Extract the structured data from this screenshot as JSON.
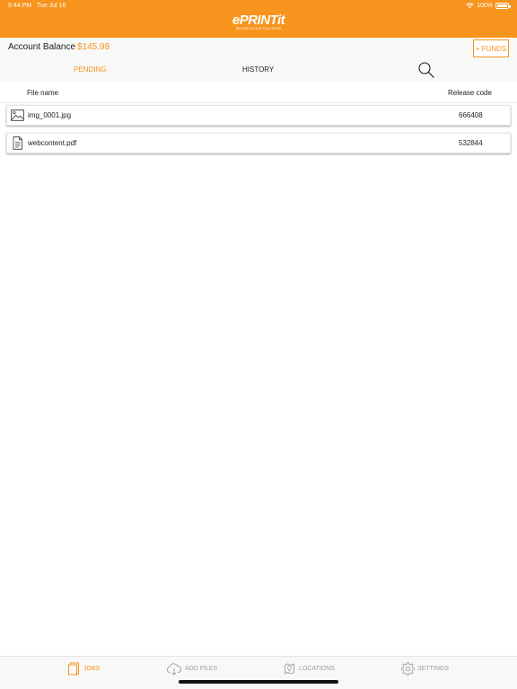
{
  "status_bar": {
    "time": "5:44 PM",
    "date": "Tue Jul 16",
    "battery": "100%"
  },
  "logo": {
    "name": "ePRINTit",
    "tagline": "SECURE CLOUD SOLUTIONS"
  },
  "account": {
    "label": "Account Balance",
    "balance": "$145.98",
    "funds_button": "+ FUNDS"
  },
  "tabs": {
    "pending": "PENDING",
    "history": "HISTORY",
    "active": "pending"
  },
  "table": {
    "headers": {
      "file_name": "File name",
      "release_code": "Release code"
    },
    "rows": [
      {
        "icon": "image-file-icon",
        "file_name": "img_0001.jpg",
        "release_code": "666408"
      },
      {
        "icon": "document-file-icon",
        "file_name": "webcontent.pdf",
        "release_code": "532844"
      }
    ]
  },
  "bottom_nav": {
    "items": [
      {
        "label": "JOBS",
        "icon": "jobs-icon",
        "active": true
      },
      {
        "label": "ADD FILES",
        "icon": "cloud-upload-icon",
        "active": false
      },
      {
        "label": "LOCATIONS",
        "icon": "location-pin-icon",
        "active": false
      },
      {
        "label": "SETTINGS",
        "icon": "gear-icon",
        "active": false
      }
    ]
  },
  "colors": {
    "accent": "#f7941d",
    "inactive": "#9b9b9b",
    "bar_background": "#f8f8f8"
  }
}
